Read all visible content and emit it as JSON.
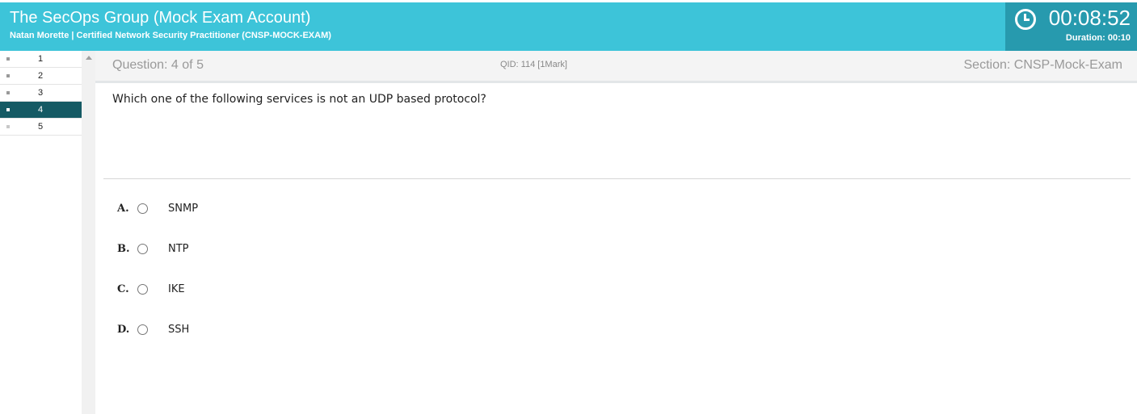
{
  "header": {
    "title": "The SecOps Group (Mock Exam Account)",
    "subtitle": "Natan Morette | Certified Network Security Practitioner (CNSP-MOCK-EXAM)",
    "timer": "00:08:52",
    "duration": "Duration: 00:10",
    "color": "#3dc4d9",
    "timer_bg": "#279aae"
  },
  "sidebar": {
    "questions": [
      {
        "label": "1",
        "state": "answered"
      },
      {
        "label": "2",
        "state": "answered"
      },
      {
        "label": "3",
        "state": "answered"
      },
      {
        "label": "4",
        "state": "current"
      },
      {
        "label": "5",
        "state": "unanswered"
      }
    ],
    "active_color": "#155a64"
  },
  "question_bar": {
    "question": "Question: 4 of 5",
    "qid": "QID: 114  [1Mark]",
    "section": "Section:  CNSP-Mock-Exam"
  },
  "question": {
    "text": "Which one of the following services is not an UDP based protocol?",
    "options": [
      {
        "letter": "A.",
        "text": "SNMP"
      },
      {
        "letter": "B.",
        "text": "NTP"
      },
      {
        "letter": "C.",
        "text": "IKE"
      },
      {
        "letter": "D.",
        "text": "SSH"
      }
    ]
  }
}
